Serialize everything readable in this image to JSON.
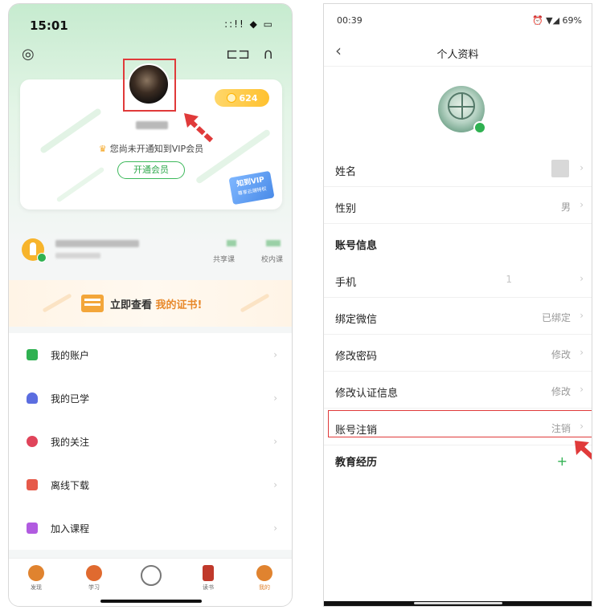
{
  "left": {
    "status": {
      "time": "15:01",
      "icons": "::!! ◆ ▭"
    },
    "coin_count": "624",
    "vip_note": "您尚未开通知到VIP会员",
    "open_vip": "开通会员",
    "vip_tag_main": "知到VIP",
    "vip_tag_sub": "尊享云端特权",
    "stats": {
      "shared_label": "共享课",
      "school_label": "校内课"
    },
    "banner": {
      "prefix": "立即查看 ",
      "highlight": "我的证书!"
    },
    "menu": [
      {
        "label": "我的账户",
        "color": "#2fb151"
      },
      {
        "label": "我的已学",
        "color": "#5b6de0"
      },
      {
        "label": "我的关注",
        "color": "#e0445a"
      },
      {
        "label": "离线下载",
        "color": "#e65a4a"
      },
      {
        "label": "加入课程",
        "color": "#b15be0"
      }
    ],
    "tabs": [
      {
        "label": "发现",
        "color": "#e0832f"
      },
      {
        "label": "学习",
        "color": "#e06a2f"
      },
      {
        "label": "",
        "color": "#777777"
      },
      {
        "label": "读书",
        "color": "#c0392b"
      },
      {
        "label": "我的",
        "color": "#e0832f"
      }
    ]
  },
  "right": {
    "status": {
      "time": "00:39",
      "right": "⏰ ▼◢ 69%"
    },
    "title": "个人资料",
    "rows": {
      "name": {
        "label": "姓名"
      },
      "gender": {
        "label": "性别",
        "value": "男"
      },
      "section_account": "账号信息",
      "phone": {
        "label": "手机",
        "value": "1"
      },
      "wechat": {
        "label": "绑定微信",
        "value": "已绑定"
      },
      "password": {
        "label": "修改密码",
        "value": "修改"
      },
      "cert": {
        "label": "修改认证信息",
        "value": "修改"
      },
      "cancel": {
        "label": "账号注销",
        "value": "注销"
      },
      "section_edu": "教育经历",
      "edu_add": "+"
    }
  },
  "colors": {
    "accent_green": "#2fb151",
    "highlight_red": "#e03a3a",
    "coin_gold": "#ffc12f"
  }
}
